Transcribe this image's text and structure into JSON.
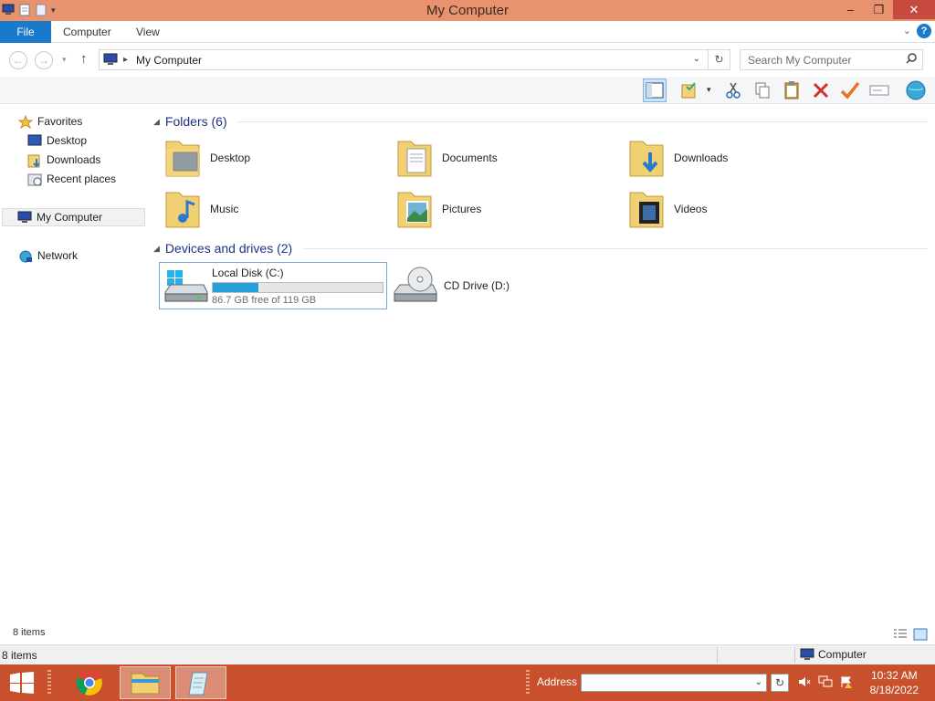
{
  "window": {
    "title": "My Computer",
    "min": "‒",
    "max": "❐",
    "close": "✕"
  },
  "ribbon": {
    "file": "File",
    "tabs": [
      "Computer",
      "View"
    ],
    "help": "?"
  },
  "nav": {
    "address": "My Computer",
    "search_placeholder": "Search My Computer"
  },
  "sidebar": {
    "favorites": "Favorites",
    "fav_items": [
      "Desktop",
      "Downloads",
      "Recent places"
    ],
    "computer": "My Computer",
    "network": "Network"
  },
  "folders": {
    "header": "Folders (6)",
    "items": [
      "Desktop",
      "Documents",
      "Downloads",
      "Music",
      "Pictures",
      "Videos"
    ]
  },
  "devices": {
    "header": "Devices and drives (2)",
    "drive_c": {
      "name": "Local Disk (C:)",
      "free": "86.7 GB free of 119 GB",
      "used_fraction": 0.27
    },
    "drive_d": {
      "name": "CD Drive (D:)"
    }
  },
  "status": {
    "items": "8 items",
    "items2": "8 items",
    "location": "Computer"
  },
  "taskbar": {
    "address_label": "Address",
    "time": "10:32 AM",
    "date": "8/18/2022"
  },
  "colors": {
    "accent": "#1979ca",
    "titlebar": "#e8926e",
    "taskbar": "#c8502c",
    "progress": "#26a0da"
  }
}
